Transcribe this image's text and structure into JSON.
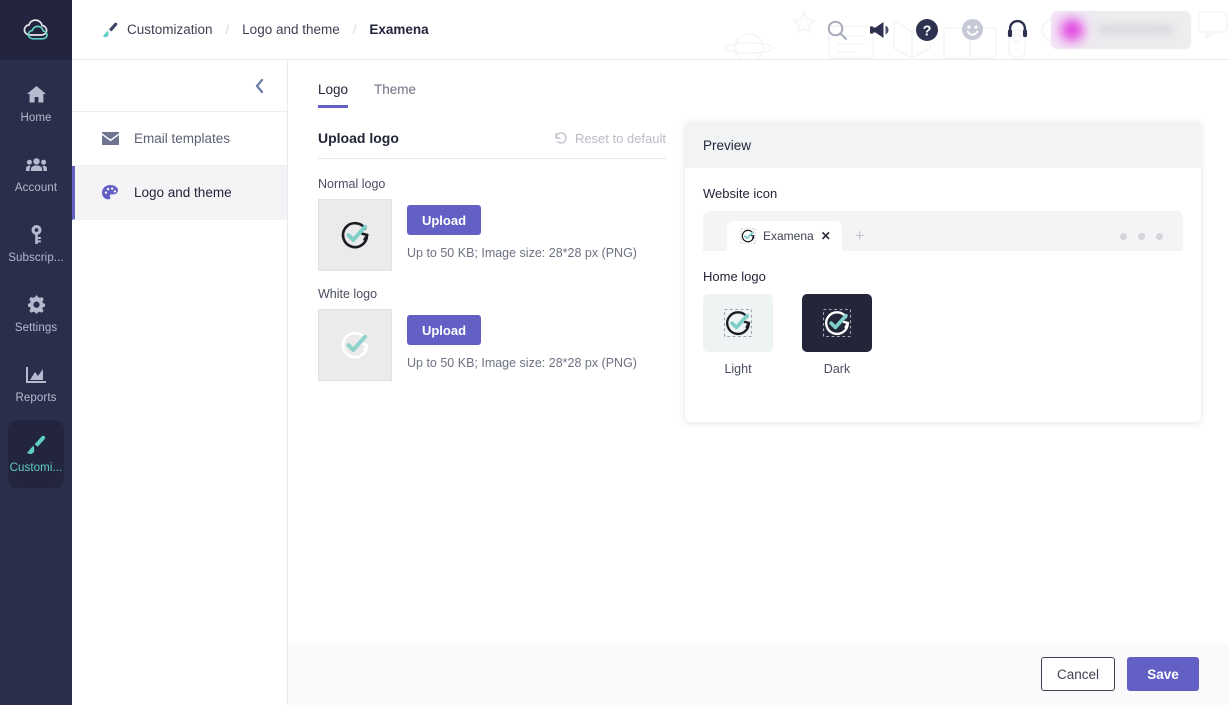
{
  "brand": {
    "logo_icon": "cloud-logo",
    "accent": "#6360c5",
    "teal": "#5ecfc4",
    "rail_bg": "#2b2e4a"
  },
  "rail": {
    "items": [
      {
        "label": "Home",
        "icon": "home-icon",
        "active": false
      },
      {
        "label": "Account",
        "icon": "users-icon",
        "active": false
      },
      {
        "label": "Subscrip...",
        "icon": "key-icon",
        "active": false
      },
      {
        "label": "Settings",
        "icon": "gear-icon",
        "active": false
      },
      {
        "label": "Reports",
        "icon": "chart-icon",
        "active": false
      },
      {
        "label": "Customi...",
        "icon": "brush-icon",
        "active": true
      }
    ]
  },
  "header": {
    "breadcrumb_icon": "brush-icon",
    "breadcrumb": [
      {
        "label": "Customization"
      },
      {
        "label": "Logo and theme"
      },
      {
        "label": "Examena"
      }
    ],
    "separator": "/",
    "icons": [
      {
        "name": "search-icon"
      },
      {
        "name": "megaphone-icon"
      },
      {
        "name": "help-circle-icon"
      },
      {
        "name": "smiley-icon"
      },
      {
        "name": "headset-icon"
      }
    ],
    "user_chip": "avatar-redacted"
  },
  "subnav": {
    "collapse_icon": "chevron-left-icon",
    "items": [
      {
        "label": "Email templates",
        "icon": "envelope-icon",
        "active": false
      },
      {
        "label": "Logo and theme",
        "icon": "palette-icon",
        "active": true
      }
    ]
  },
  "main": {
    "tabs": [
      {
        "label": "Logo",
        "active": true
      },
      {
        "label": "Theme",
        "active": false
      }
    ],
    "section_title": "Upload logo",
    "reset": {
      "label": "Reset to default",
      "icon": "reset-arrow-icon",
      "disabled": true
    },
    "blocks": [
      {
        "label": "Normal logo",
        "upload_label": "Upload",
        "hint": "Up to 50 KB; Image size: 28*28 px (PNG)",
        "variant": "normal"
      },
      {
        "label": "White logo",
        "upload_label": "Upload",
        "hint": "Up to 50 KB; Image size: 28*28 px (PNG)",
        "variant": "white"
      }
    ]
  },
  "preview": {
    "title": "Preview",
    "website_icon_label": "Website icon",
    "browser": {
      "tab_title": "Examena",
      "close_icon": "close-icon",
      "new_tab_icon": "plus-icon",
      "menu_dots": 3
    },
    "home_logo_label": "Home logo",
    "home_logos": [
      {
        "caption": "Light",
        "mode": "light"
      },
      {
        "caption": "Dark",
        "mode": "dark"
      }
    ]
  },
  "footer": {
    "cancel_label": "Cancel",
    "save_label": "Save"
  }
}
